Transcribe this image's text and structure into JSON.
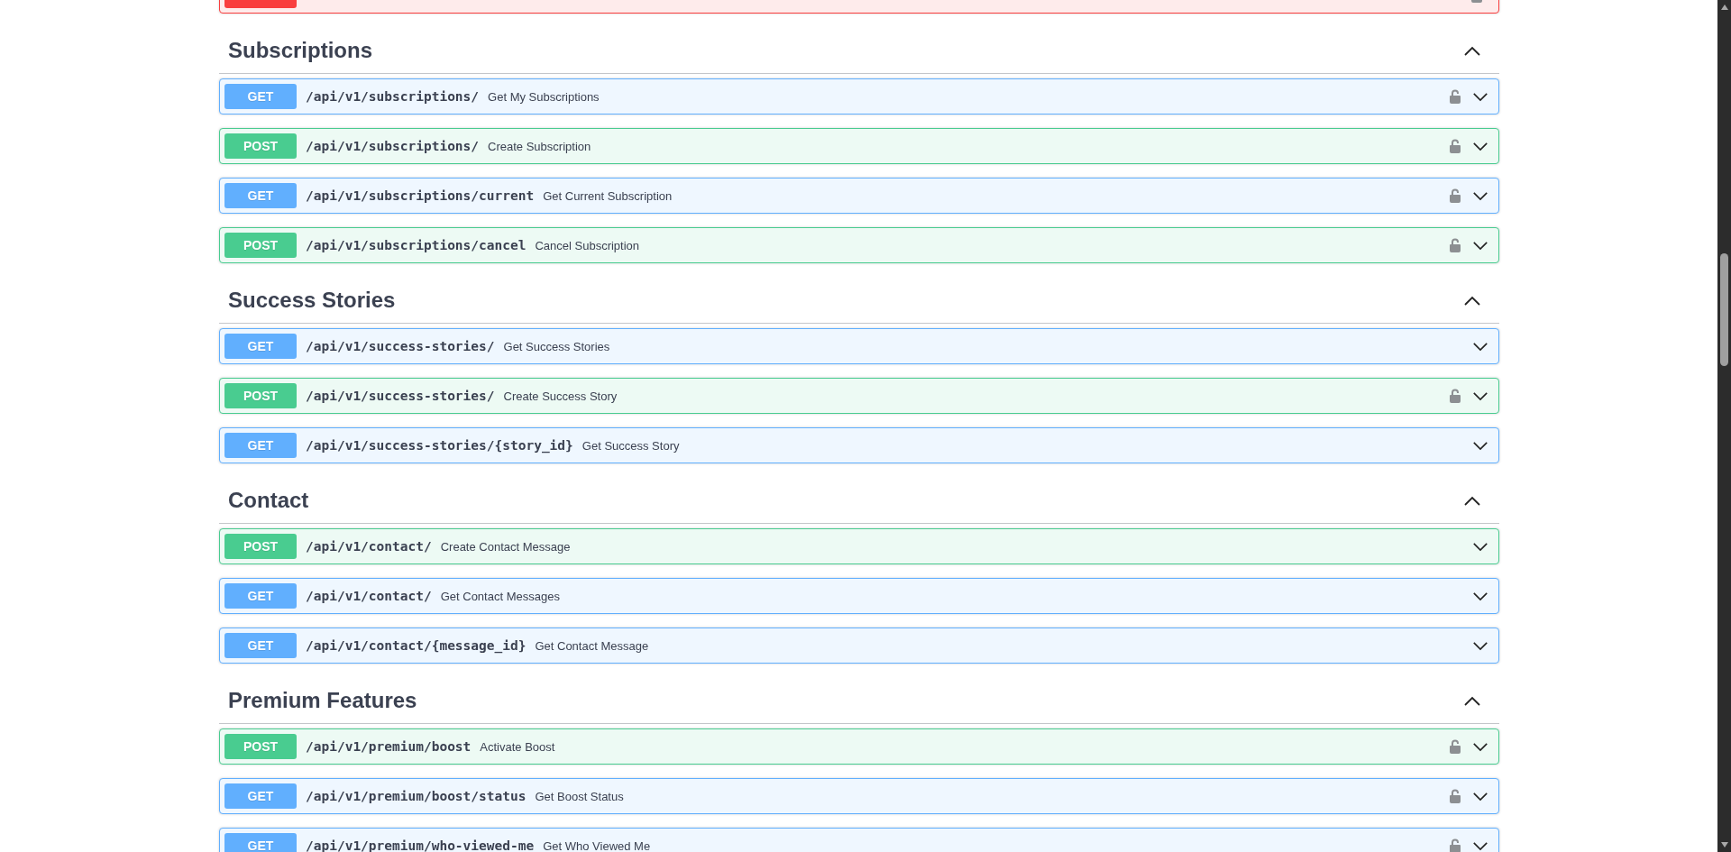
{
  "cut_off_row": {
    "kind": "delete",
    "locked": true
  },
  "sections": [
    {
      "title": "Subscriptions",
      "expanded": true,
      "operations": [
        {
          "kind": "get",
          "method": "GET",
          "path": "/api/v1/subscriptions/",
          "summary": "Get My Subscriptions",
          "locked": true
        },
        {
          "kind": "post",
          "method": "POST",
          "path": "/api/v1/subscriptions/",
          "summary": "Create Subscription",
          "locked": true
        },
        {
          "kind": "get",
          "method": "GET",
          "path": "/api/v1/subscriptions/current",
          "summary": "Get Current Subscription",
          "locked": true
        },
        {
          "kind": "post",
          "method": "POST",
          "path": "/api/v1/subscriptions/cancel",
          "summary": "Cancel Subscription",
          "locked": true
        }
      ]
    },
    {
      "title": "Success Stories",
      "expanded": true,
      "operations": [
        {
          "kind": "get",
          "method": "GET",
          "path": "/api/v1/success-stories/",
          "summary": "Get Success Stories",
          "locked": false
        },
        {
          "kind": "post",
          "method": "POST",
          "path": "/api/v1/success-stories/",
          "summary": "Create Success Story",
          "locked": true
        },
        {
          "kind": "get",
          "method": "GET",
          "path": "/api/v1/success-stories/{story_id}",
          "summary": "Get Success Story",
          "locked": false
        }
      ]
    },
    {
      "title": "Contact",
      "expanded": true,
      "operations": [
        {
          "kind": "post",
          "method": "POST",
          "path": "/api/v1/contact/",
          "summary": "Create Contact Message",
          "locked": false
        },
        {
          "kind": "get",
          "method": "GET",
          "path": "/api/v1/contact/",
          "summary": "Get Contact Messages",
          "locked": false
        },
        {
          "kind": "get",
          "method": "GET",
          "path": "/api/v1/contact/{message_id}",
          "summary": "Get Contact Message",
          "locked": false
        }
      ]
    },
    {
      "title": "Premium Features",
      "expanded": true,
      "operations": [
        {
          "kind": "post",
          "method": "POST",
          "path": "/api/v1/premium/boost",
          "summary": "Activate Boost",
          "locked": true
        },
        {
          "kind": "get",
          "method": "GET",
          "path": "/api/v1/premium/boost/status",
          "summary": "Get Boost Status",
          "locked": true
        },
        {
          "kind": "get",
          "method": "GET",
          "path": "/api/v1/premium/who-viewed-me",
          "summary": "Get Who Viewed Me",
          "locked": true
        }
      ]
    }
  ]
}
